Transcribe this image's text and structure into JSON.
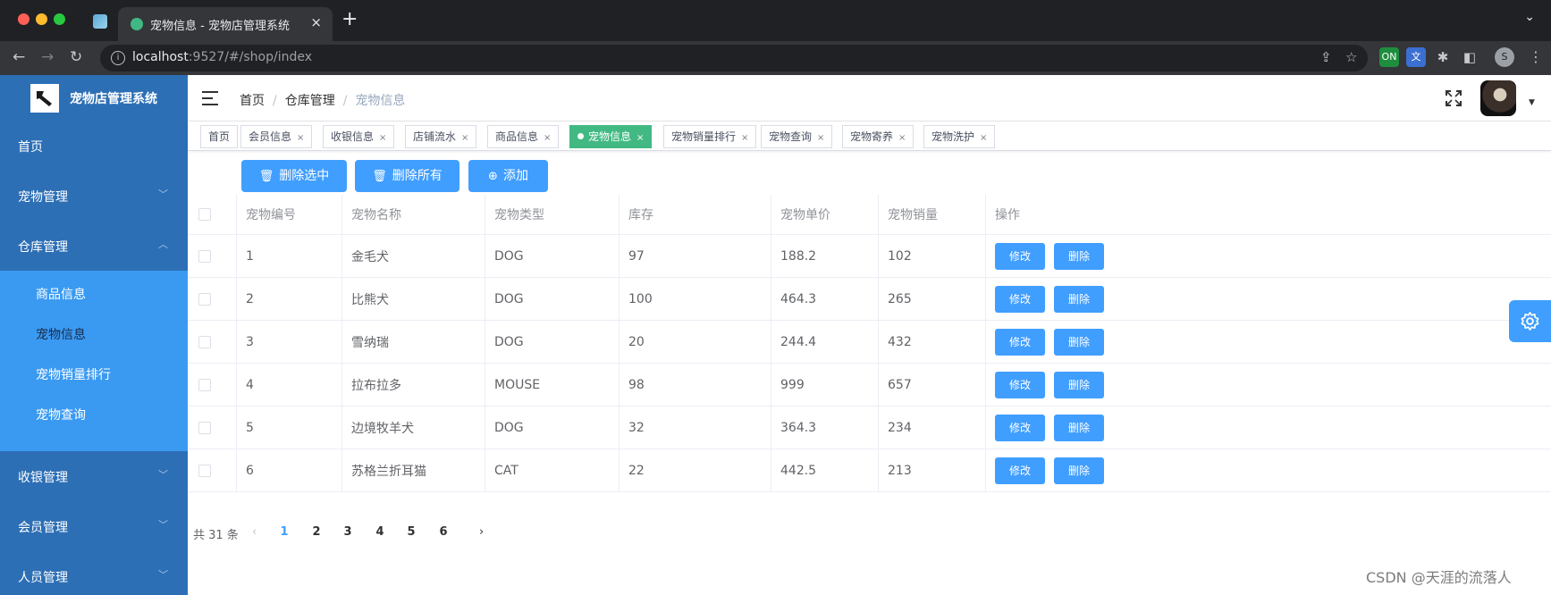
{
  "browser": {
    "tab_title": "宠物信息 - 宠物店管理系统",
    "tab_close": "×",
    "new_tab": "+",
    "url_host": "localhost",
    "url_rest": ":9527/#/shop/index",
    "profile_initial": "S"
  },
  "sidebar": {
    "title": "宠物店管理系统",
    "items": [
      {
        "label": "首页"
      },
      {
        "label": "宠物管理",
        "arrow": "﹀"
      },
      {
        "label": "仓库管理",
        "arrow": "︿"
      },
      {
        "label": "收银管理",
        "arrow": "﹀"
      },
      {
        "label": "会员管理",
        "arrow": "﹀"
      },
      {
        "label": "人员管理",
        "arrow": "﹀"
      }
    ],
    "submenu": [
      {
        "label": "商品信息"
      },
      {
        "label": "宠物信息",
        "active": true
      },
      {
        "label": "宠物销量排行"
      },
      {
        "label": "宠物查询"
      }
    ]
  },
  "header": {
    "breadcrumb": [
      "首页",
      "仓库管理",
      "宠物信息"
    ],
    "separator": "/"
  },
  "tags": [
    {
      "label": "首页"
    },
    {
      "label": "会员信息",
      "close": "×"
    },
    {
      "label": "收银信息",
      "close": "×"
    },
    {
      "label": "店铺流水",
      "close": "×"
    },
    {
      "label": "商品信息",
      "close": "×"
    },
    {
      "label": "宠物信息",
      "close": "×",
      "active": true
    },
    {
      "label": "宠物销量排行",
      "close": "×"
    },
    {
      "label": "宠物查询",
      "close": "×"
    },
    {
      "label": "宠物寄养",
      "close": "×"
    },
    {
      "label": "宠物洗护",
      "close": "×"
    }
  ],
  "toolbar": {
    "delete_selected": "删除选中",
    "delete_all": "删除所有",
    "add": "添加"
  },
  "table": {
    "columns": [
      "宠物编号",
      "宠物名称",
      "宠物类型",
      "库存",
      "宠物单价",
      "宠物销量",
      "操作"
    ],
    "edit_label": "修改",
    "delete_label": "删除",
    "rows": [
      {
        "id": "1",
        "name": "金毛犬",
        "type": "DOG",
        "stock": "97",
        "price": "188.2",
        "sales": "102"
      },
      {
        "id": "2",
        "name": "比熊犬",
        "type": "DOG",
        "stock": "100",
        "price": "464.3",
        "sales": "265"
      },
      {
        "id": "3",
        "name": "雪纳瑞",
        "type": "DOG",
        "stock": "20",
        "price": "244.4",
        "sales": "432"
      },
      {
        "id": "4",
        "name": "拉布拉多",
        "type": "MOUSE",
        "stock": "98",
        "price": "999",
        "sales": "657"
      },
      {
        "id": "5",
        "name": "边境牧羊犬",
        "type": "DOG",
        "stock": "32",
        "price": "364.3",
        "sales": "234"
      },
      {
        "id": "6",
        "name": "苏格兰折耳猫",
        "type": "CAT",
        "stock": "22",
        "price": "442.5",
        "sales": "213"
      }
    ]
  },
  "pagination": {
    "total": "共 31 条",
    "prev": "‹",
    "next": "›",
    "pages": [
      "1",
      "2",
      "3",
      "4",
      "5",
      "6"
    ],
    "current": 1
  },
  "watermark": "CSDN @天涯的流落人",
  "colors": {
    "sidebar": "#2d6fb5",
    "submenu": "#3a9af2",
    "primary": "#409eff",
    "active_tag": "#42b983"
  }
}
